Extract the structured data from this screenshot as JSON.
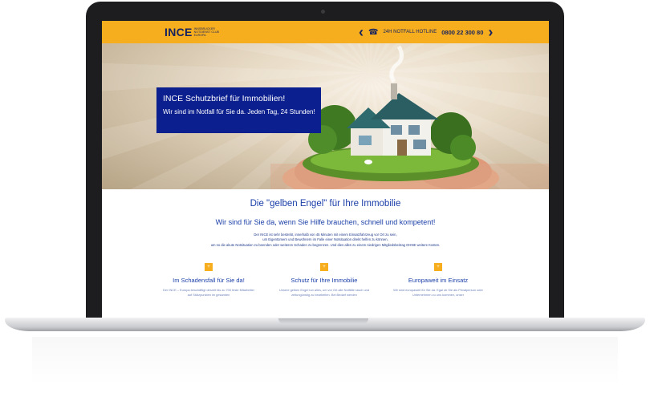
{
  "header": {
    "logo_text": "INCE",
    "logo_sub": "Innsbrucker Notdienst Club Europa",
    "phone_icon": "phone-icon",
    "hotline_label": "24H NOTFALL HOTLINE",
    "hotline_number": "0800 22 300 80"
  },
  "hero": {
    "title": "INCE Schutzbrief für Immobilien!",
    "subtitle": "Wir sind im Notfall für Sie da. Jeden Tag, 24 Stunden!"
  },
  "content": {
    "main_heading": "Die \"gelben Engel\" für Ihre Immobilie",
    "sub_heading": "Wir sind für Sie da, wenn Sie Hilfe brauchen, schnell und kompetent!",
    "intro_lines": [
      "Der INCE ist sehr bestrebt, innerhalb von 45 Minuten mit einem Einsatzfahrzeug vor Ort zu sein,",
      "um Eigentümern und Bewohnern im Falle einer Notsituation direkt helfen zu können,",
      "um so die akute Notsituation zu beenden oder weiteren Schaden zu begrenzen. Und dies alles zu einem niedrigen Mitgliedsbeitrag OHNE weitere Kosten."
    ]
  },
  "features": [
    {
      "title": "Im Schadensfall für Sie da!",
      "text": "Der INCE – Europa beschäftigt derzeit bis zu 700 feste Mitarbeiter auf Stützpunkten im gesamten"
    },
    {
      "title": "Schutz für Ihre Immobilie",
      "text": "Unsere gelben Engel tun alles, um vor Ort alle Notfälle rasch und zeitungünstig zu bearbeiten. Bei Bedarf werden"
    },
    {
      "title": "Europaweit im Einsatz",
      "text": "Wir sind europaweit für Sie da. Egal ob Sie als Privatperson oder Unternehmen zu uns kommen, unser"
    }
  ],
  "colors": {
    "header_yellow": "#f6ad1e",
    "hero_box_blue": "#0b1f8f",
    "heading_blue": "#1a3ea8"
  }
}
